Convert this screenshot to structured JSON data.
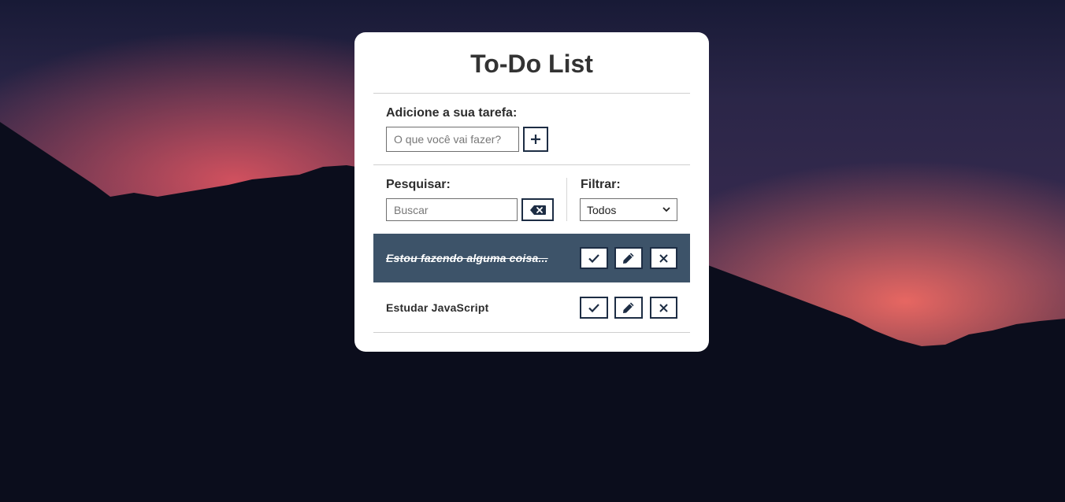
{
  "app": {
    "title": "To-Do List"
  },
  "add_section": {
    "label": "Adicione a sua tarefa:",
    "input_placeholder": "O que você vai fazer?",
    "input_value": "",
    "add_button_icon": "plus-icon",
    "add_button_symbol": "+"
  },
  "search_section": {
    "label": "Pesquisar:",
    "input_placeholder": "Buscar",
    "input_value": "",
    "clear_button_icon": "backspace-icon"
  },
  "filter_section": {
    "label": "Filtrar:",
    "selected": "Todos"
  },
  "todos": [
    {
      "text": "Estou fazendo alguma coisa...",
      "done": true,
      "actions": [
        "check-icon",
        "pencil-icon",
        "close-icon"
      ]
    },
    {
      "text": "Estudar JavaScript",
      "done": false,
      "actions": [
        "check-icon",
        "pencil-icon",
        "close-icon"
      ]
    }
  ],
  "colors": {
    "card_bg": "#ffffff",
    "done_row_bg": "#3d5369",
    "icon_color": "#1d2d44",
    "text_color": "#2d2d2d"
  }
}
